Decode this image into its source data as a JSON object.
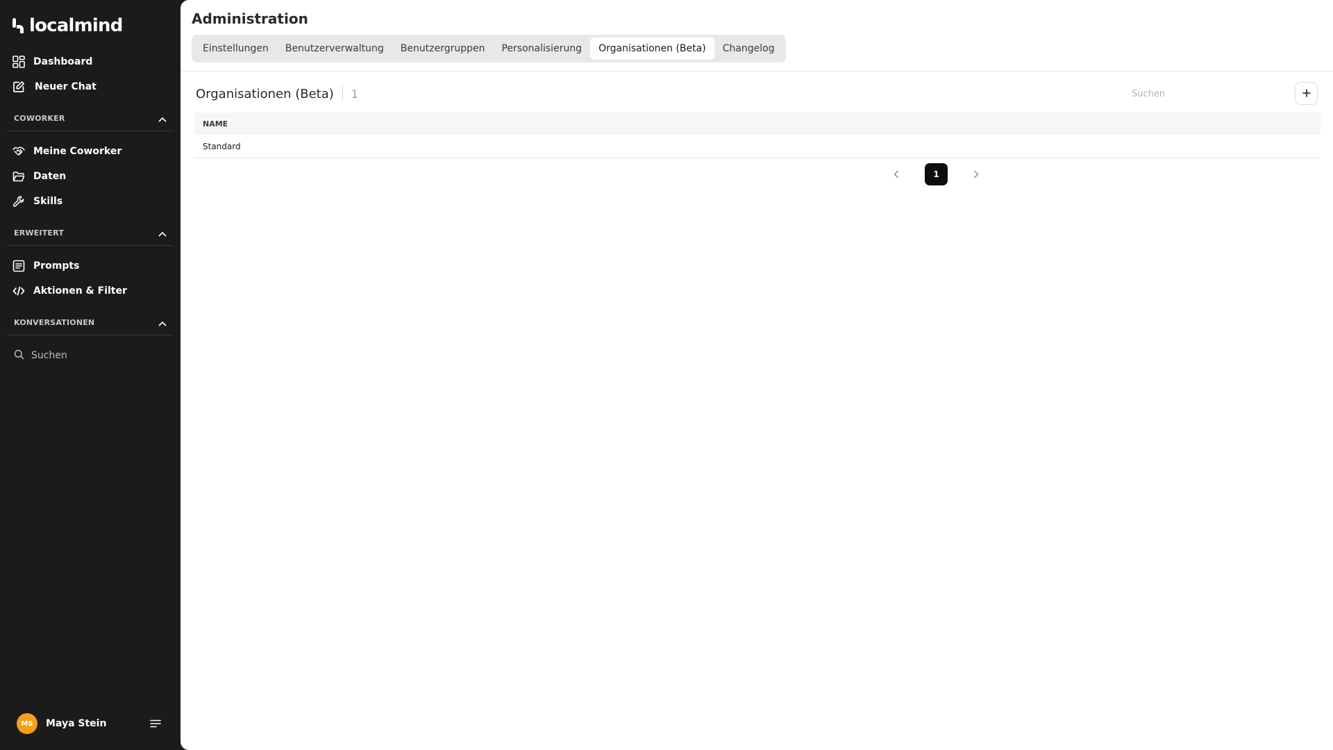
{
  "app": {
    "logo_text": "localmind"
  },
  "sidebar": {
    "top_items": [
      {
        "label": "Dashboard",
        "icon": "dashboard-grid-icon"
      },
      {
        "label": "Neuer Chat",
        "icon": "edit-icon"
      }
    ],
    "sections": [
      {
        "label": "COWORKER",
        "items": [
          {
            "label": "Meine Coworker",
            "icon": "handshake-icon"
          },
          {
            "label": "Daten",
            "icon": "folder-icon"
          },
          {
            "label": "Skills",
            "icon": "wrench-icon"
          }
        ]
      },
      {
        "label": "ERWEITERT",
        "items": [
          {
            "label": "Prompts",
            "icon": "document-list-icon"
          },
          {
            "label": "Aktionen & Filter",
            "icon": "code-icon"
          }
        ]
      },
      {
        "label": "KONVERSATIONEN",
        "items": []
      }
    ],
    "search_label": "Suchen",
    "user": {
      "initials": "MS",
      "name": "Maya Stein",
      "avatar_color": "#f5a01a"
    }
  },
  "main": {
    "title": "Administration",
    "tabs": [
      {
        "label": "Einstellungen",
        "active": false
      },
      {
        "label": "Benutzerverwaltung",
        "active": false
      },
      {
        "label": "Benutzergruppen",
        "active": false
      },
      {
        "label": "Personalisierung",
        "active": false
      },
      {
        "label": "Organisationen (Beta)",
        "active": true
      },
      {
        "label": "Changelog",
        "active": false
      }
    ],
    "section": {
      "title": "Organisationen (Beta)",
      "count": "1",
      "search_placeholder": "Suchen",
      "add_icon": "plus-icon"
    },
    "table": {
      "columns": [
        "NAME"
      ],
      "rows": [
        {
          "name": "Standard"
        }
      ]
    },
    "pagination": {
      "current_page": "1"
    }
  }
}
